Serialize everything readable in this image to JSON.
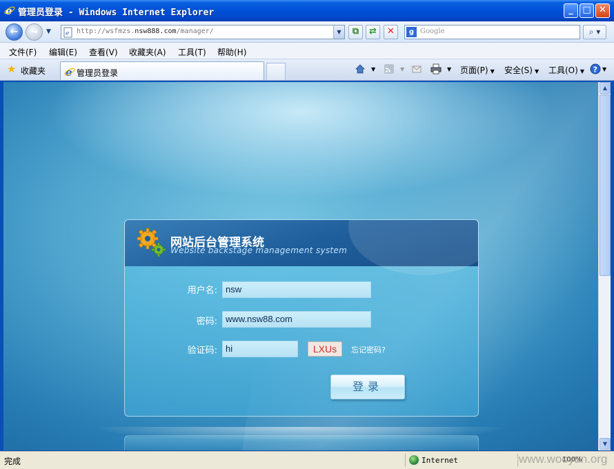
{
  "window": {
    "title": "管理员登录 - Windows Internet Explorer"
  },
  "address_bar": {
    "url_prefix": "http://wsfmzs.",
    "url_host": "nsw888.com",
    "url_suffix": "/manager/"
  },
  "search": {
    "placeholder": "Google",
    "provider_letter": "g"
  },
  "menu": {
    "items": [
      "文件(F)",
      "编辑(E)",
      "查看(V)",
      "收藏夹(A)",
      "工具(T)",
      "帮助(H)"
    ]
  },
  "tabbar": {
    "favorites_label": "收藏夹",
    "tab_label": "管理员登录",
    "commands": {
      "page": "页面(P)",
      "safety": "安全(S)",
      "tools": "工具(O)"
    }
  },
  "login": {
    "system_title": "网站后台管理系统",
    "system_subtitle": "Website backstage management system",
    "username_label": "用户名:",
    "username_value": "nsw",
    "password_label": "密码:",
    "password_value": "www.nsw88.com",
    "captcha_label": "验证码:",
    "captcha_value": "hi",
    "captcha_image_text": "LXUs",
    "forgot_link": "忘记密码?",
    "login_button": "登录"
  },
  "status": {
    "left_text": "完成",
    "zone": "Internet",
    "zoom": "100%",
    "watermark": "www.wooyun.org"
  },
  "colors": {
    "titlebar": "#0050d8",
    "content_bg": "#4ea4cd",
    "panel_header": "#1f5f9c",
    "captcha_text": "#d22a2a"
  }
}
